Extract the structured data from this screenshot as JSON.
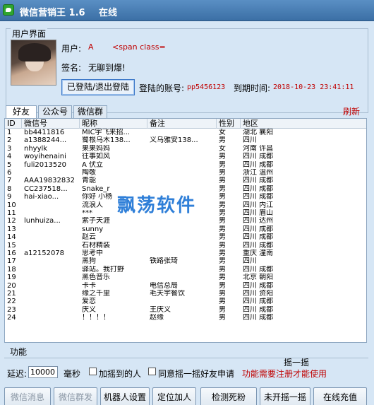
{
  "window": {
    "title": "微信营销王 1.6",
    "status": "在线"
  },
  "user_panel": {
    "group_label": "用户界面",
    "user_label": "用户:",
    "user_value": "A",
    "user_extra": "<span class=",
    "signature_label": "签名:",
    "signature_value": "无聊到爆!",
    "login_button": "已登陆/退出登陆",
    "account_label": "登陆的账号:",
    "account_value": "pp5456123",
    "expiry_label": "到期时间:",
    "expiry_value": "2018-10-23 23:41:11"
  },
  "tabs": [
    "好友",
    "公众号",
    "微信群"
  ],
  "refresh_label": "刷新",
  "table": {
    "headers": [
      "ID",
      "微信号",
      "昵称",
      "备注",
      "性别",
      "地区"
    ],
    "rows": [
      [
        "1",
        "bb4411816",
        "MIC宇飞来招...",
        "",
        "女",
        "湖北 襄阳"
      ],
      [
        "2",
        "a1388244...",
        "蜀根乌木138...",
        "义乌雅安138...",
        "男",
        "四川"
      ],
      [
        "3",
        "nhyylk",
        "果果妈妈",
        "",
        "女",
        "河南 许昌"
      ],
      [
        "4",
        "woyihenaini",
        "往事如风",
        "",
        "男",
        "四川 成都"
      ],
      [
        "5",
        "fuli2013520",
        "A 伏立",
        "",
        "男",
        "四川 成都"
      ],
      [
        "6",
        "",
        "陶敬",
        "",
        "男",
        "浙江 温州"
      ],
      [
        "7",
        "AAA19832832",
        "青能",
        "",
        "男",
        "四川 成都"
      ],
      [
        "8",
        "CC237518...",
        "Snake_r",
        "",
        "男",
        "四川 成都"
      ],
      [
        "9",
        "hai-xiao...",
        "你好  小杨",
        "",
        "男",
        "四川 成都"
      ],
      [
        "10",
        "",
        "流浪人",
        "",
        "男",
        "四川 内江"
      ],
      [
        "11",
        "",
        "***",
        "",
        "男",
        "四川 眉山"
      ],
      [
        "12",
        "lunhuiza...",
        "紫子天涯",
        "",
        "男",
        "四川 达州"
      ],
      [
        "13",
        "",
        "sunny",
        "",
        "男",
        "四川 成都"
      ],
      [
        "14",
        "",
        "赵云",
        "",
        "男",
        "四川 成都"
      ],
      [
        "15",
        "",
        "石材精装",
        "",
        "男",
        "四川 成都"
      ],
      [
        "16",
        "a12152078",
        "思考中",
        "",
        "男",
        "重庆 潼南"
      ],
      [
        "17",
        "",
        "黑狗",
        "铁路张琦",
        "男",
        "四川"
      ],
      [
        "18",
        "",
        "驿站。我打野",
        "",
        "男",
        "四川 成都"
      ],
      [
        "19",
        "",
        "黑色音乐",
        "",
        "男",
        "北京 朝阳"
      ],
      [
        "20",
        "",
        "卡卡",
        "电信总局",
        "男",
        "四川 成都"
      ],
      [
        "21",
        "",
        "缘之千里",
        "毛天宇餐饮",
        "男",
        "四川 资阳"
      ],
      [
        "22",
        "",
        "爱恋",
        "",
        "男",
        "四川 成都"
      ],
      [
        "23",
        "",
        "庆义",
        "王庆义",
        "男",
        "四川 成都"
      ],
      [
        "24",
        "",
        "！！！！",
        "赵缘",
        "男",
        "四川 成都"
      ]
    ]
  },
  "watermark": "飘荡软件",
  "function_panel": {
    "label": "功能",
    "shake_label": "摇一摇",
    "delay_label": "延迟:",
    "delay_value": "10000",
    "ms_label": "毫秒",
    "add_shaken_label": "加摇到的人",
    "agree_shake_label": "同意摇一摇好友申请",
    "need_register": "功能需要注册才能使用"
  },
  "buttons": [
    "微信消息",
    "微信群发",
    "机器人设置",
    "定位加人",
    "检测死粉",
    "未开摇一摇",
    "在线充值"
  ],
  "colors": {
    "accent_red": "#c00000",
    "titlebar": "#3b6fa5",
    "background": "#d6e6f5"
  }
}
